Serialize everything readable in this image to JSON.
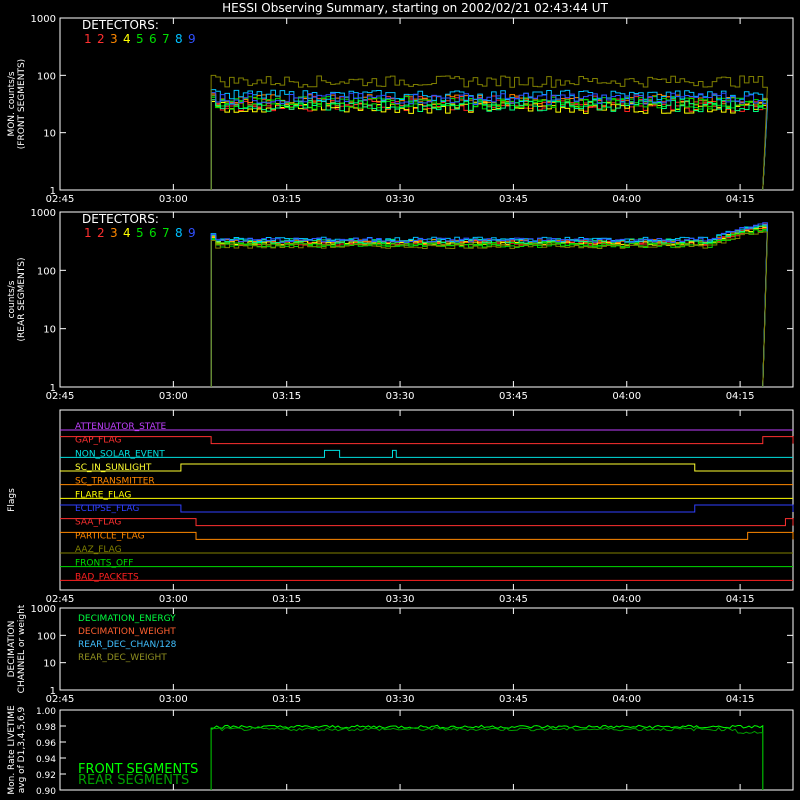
{
  "title": "HESSI Observing Summary, starting on 2002/02/21 02:43:44 UT",
  "time_ticks": [
    "02:45",
    "03:00",
    "03:15",
    "03:30",
    "03:45",
    "04:00",
    "04:15"
  ],
  "detector_colors": [
    "#ff3030",
    "#ff3030",
    "#ff8800",
    "#ffff00",
    "#00dd00",
    "#00dd00",
    "#00dd00",
    "#00c0ff",
    "#3050ff"
  ],
  "chart_data": [
    {
      "type": "line",
      "id": "front",
      "header": "DETECTORS:",
      "ylabel": [
        "MON. counts/s",
        "(FRONT SEGMENTS)"
      ],
      "yscale": "log",
      "ylim": [
        1,
        1000
      ],
      "ytick_labels": [
        "1",
        "10",
        "100",
        "1000"
      ],
      "xlim_minutes_from_0245": [
        0,
        97
      ],
      "data_start": "03:05",
      "data_end": "04:18",
      "series": [
        {
          "name": "1",
          "color": "#ff2020",
          "level": 30
        },
        {
          "name": "2",
          "color": "#ff3030",
          "level": 36
        },
        {
          "name": "3",
          "color": "#ff8800",
          "level": 38
        },
        {
          "name": "4",
          "color": "#ffff00",
          "level": 28
        },
        {
          "name": "5",
          "color": "#00dd00",
          "level": 35
        },
        {
          "name": "6",
          "color": "#00dd00",
          "level": 33
        },
        {
          "name": "7",
          "color": "#00ff80",
          "level": 30
        },
        {
          "name": "8",
          "color": "#00c0ff",
          "level": 45
        },
        {
          "name": "9",
          "color": "#3050ff",
          "level": 40
        },
        {
          "name": "",
          "color": "#808000",
          "level": 80
        }
      ]
    },
    {
      "type": "line",
      "id": "rear",
      "header": "DETECTORS:",
      "ylabel": [
        "counts/s",
        "(REAR SEGMENTS)"
      ],
      "yscale": "log",
      "ylim": [
        1,
        1000
      ],
      "ytick_labels": [
        "1",
        "10",
        "100",
        "1000"
      ],
      "data_start": "03:05",
      "data_end": "04:18",
      "series": [
        {
          "name": "1",
          "color": "#ff2020",
          "level": 290
        },
        {
          "name": "2",
          "color": "#ff3030",
          "level": 300
        },
        {
          "name": "3",
          "color": "#ff8800",
          "level": 310
        },
        {
          "name": "4",
          "color": "#ffff00",
          "level": 295
        },
        {
          "name": "5",
          "color": "#00dd00",
          "level": 280
        },
        {
          "name": "6",
          "color": "#00dd00",
          "level": 270
        },
        {
          "name": "7",
          "color": "#00ff80",
          "level": 320
        },
        {
          "name": "8",
          "color": "#00c0ff",
          "level": 340
        },
        {
          "name": "9",
          "color": "#3050ff",
          "level": 330
        },
        {
          "name": "",
          "color": "#808000",
          "level": 260
        }
      ]
    },
    {
      "type": "line",
      "id": "flags",
      "ylabel": [
        "Flags"
      ],
      "flags": [
        {
          "label": "ATTENUATOR_STATE",
          "color": "#c040ff",
          "high": []
        },
        {
          "label": "GAP_FLAG",
          "color": "#ff3030",
          "high": [
            [
              "02:45",
              "03:05"
            ],
            [
              "04:18",
              "04:22"
            ]
          ]
        },
        {
          "label": "NON_SOLAR_EVENT",
          "color": "#00e0e0",
          "high": [
            [
              "03:20",
              "03:22"
            ],
            [
              "03:29",
              "03:29.5"
            ]
          ]
        },
        {
          "label": "SC_IN_SUNLIGHT",
          "color": "#ffff30",
          "high": [
            [
              "03:01",
              "04:09"
            ]
          ]
        },
        {
          "label": "SC_TRANSMITTER",
          "color": "#ff8800",
          "high": []
        },
        {
          "label": "FLARE_FLAG",
          "color": "#ffff00",
          "high": []
        },
        {
          "label": "ECLIPSE_FLAG",
          "color": "#3040ff",
          "high": [
            [
              "02:45",
              "03:01"
            ],
            [
              "04:09",
              "04:22"
            ]
          ]
        },
        {
          "label": "SAA_FLAG",
          "color": "#ff3030",
          "high": [
            [
              "02:45",
              "03:03"
            ],
            [
              "04:21",
              "04:22"
            ]
          ]
        },
        {
          "label": "PARTICLE_FLAG",
          "color": "#ff8800",
          "high": [
            [
              "02:45",
              "03:03"
            ],
            [
              "04:16",
              "04:22"
            ]
          ]
        },
        {
          "label": "AAZ_FLAG",
          "color": "#808000",
          "high": []
        },
        {
          "label": "FRONTS_OFF",
          "color": "#00dd00",
          "high": []
        },
        {
          "label": "BAD_PACKETS",
          "color": "#ff2020",
          "high": []
        }
      ]
    },
    {
      "type": "line",
      "id": "decimation",
      "ylabel": [
        "DECIMATION",
        "CHANNEL or weight"
      ],
      "yscale": "log",
      "ylim": [
        1,
        1000
      ],
      "ytick_labels": [
        "1",
        "10",
        "100",
        "1000"
      ],
      "legend": [
        {
          "label": "DECIMATION_ENERGY",
          "color": "#00ff40"
        },
        {
          "label": "DECIMATION_WEIGHT",
          "color": "#ff6030"
        },
        {
          "label": "REAR_DEC_CHAN/128",
          "color": "#40c0ff"
        },
        {
          "label": "REAR_DEC_WEIGHT",
          "color": "#909020"
        }
      ]
    },
    {
      "type": "line",
      "id": "livetime",
      "ylabel": [
        "Mon. Rate LIVETIME",
        "avg of D1,3,4,5,6,9"
      ],
      "ylim": [
        0.9,
        1.0
      ],
      "ytick_labels": [
        "0.90",
        "0.92",
        "0.94",
        "0.96",
        "0.98",
        "1.00"
      ],
      "data_start": "03:05",
      "data_end": "04:18",
      "series": [
        {
          "name": "FRONT SEGMENTS",
          "color": "#00ff00",
          "level": 0.979
        },
        {
          "name": "REAR SEGMENTS",
          "color": "#00a000",
          "level": 0.976
        }
      ]
    }
  ]
}
